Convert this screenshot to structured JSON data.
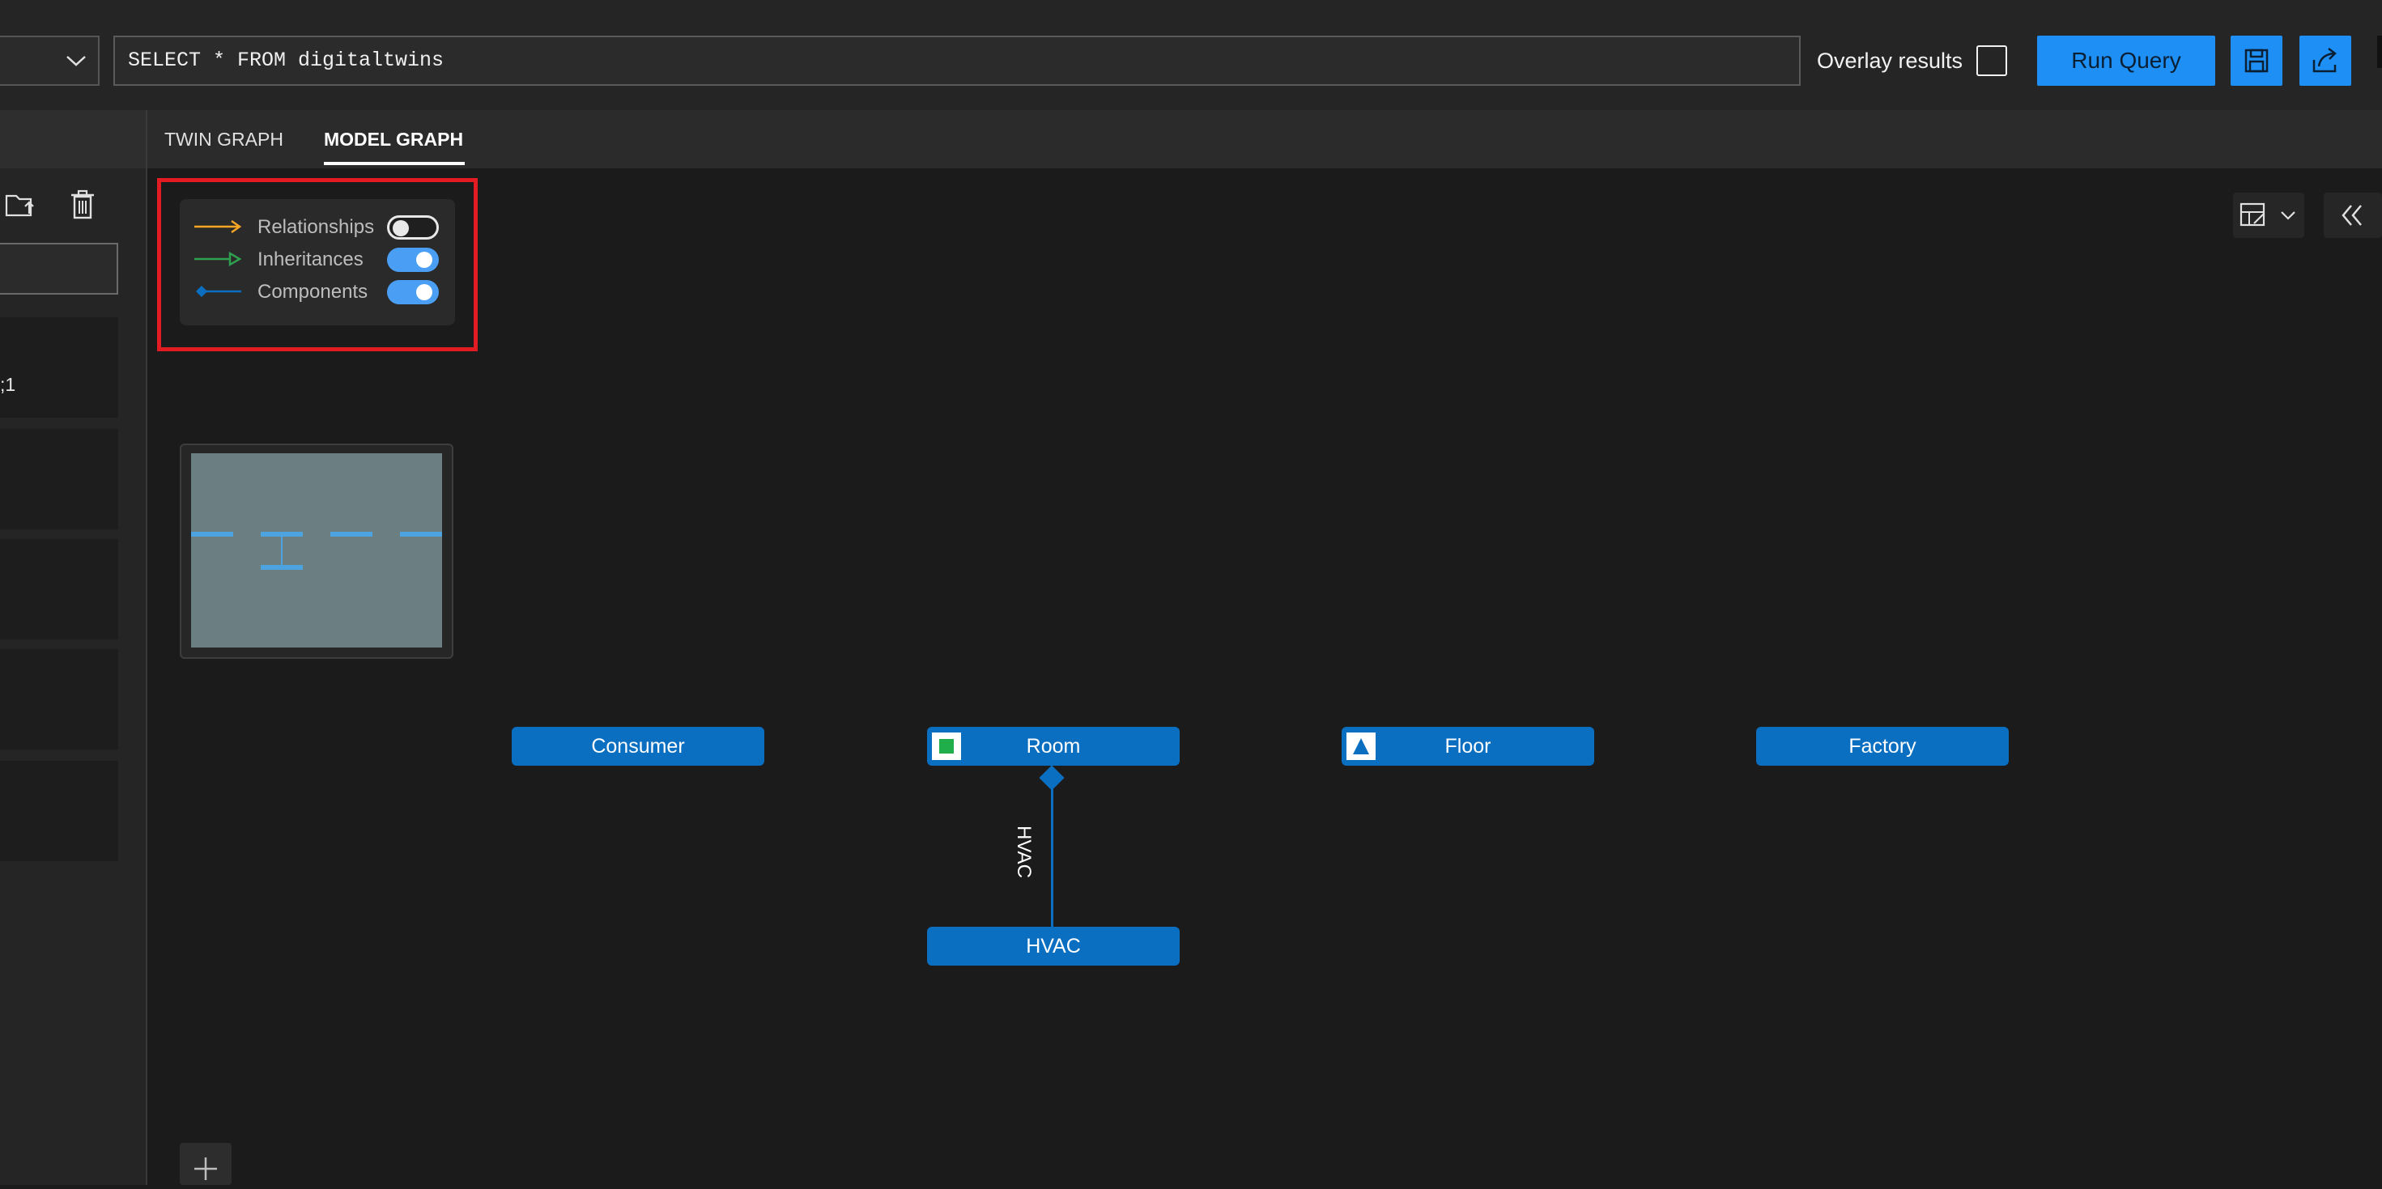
{
  "query": {
    "text": "SELECT * FROM digitaltwins",
    "overlay_label": "Overlay results",
    "overlay_checked": false,
    "run_label": "Run Query"
  },
  "left": {
    "card_text": ";1"
  },
  "tabs": [
    {
      "label": "TWIN GRAPH",
      "active": false
    },
    {
      "label": "MODEL GRAPH",
      "active": true
    }
  ],
  "legend": {
    "relationships": {
      "label": "Relationships",
      "enabled": false,
      "color": "#f5a623"
    },
    "inheritances": {
      "label": "Inheritances",
      "enabled": true,
      "color": "#2e9e4f"
    },
    "components": {
      "label": "Components",
      "enabled": true,
      "color": "#0a6ec1"
    }
  },
  "nodes": [
    {
      "label": "Consumer",
      "icon": ""
    },
    {
      "label": "Room",
      "icon": "green-square-icon"
    },
    {
      "label": "Floor",
      "icon": "blue-triangle-icon"
    },
    {
      "label": "Factory",
      "icon": ""
    },
    {
      "label": "HVAC",
      "icon": ""
    }
  ],
  "edge": {
    "label": "HVAC",
    "from": "Room",
    "to": "HVAC",
    "type": "component"
  },
  "colors": {
    "accent": "#1e90f5",
    "node": "#0a6ec1",
    "highlight": "#e31b23"
  }
}
